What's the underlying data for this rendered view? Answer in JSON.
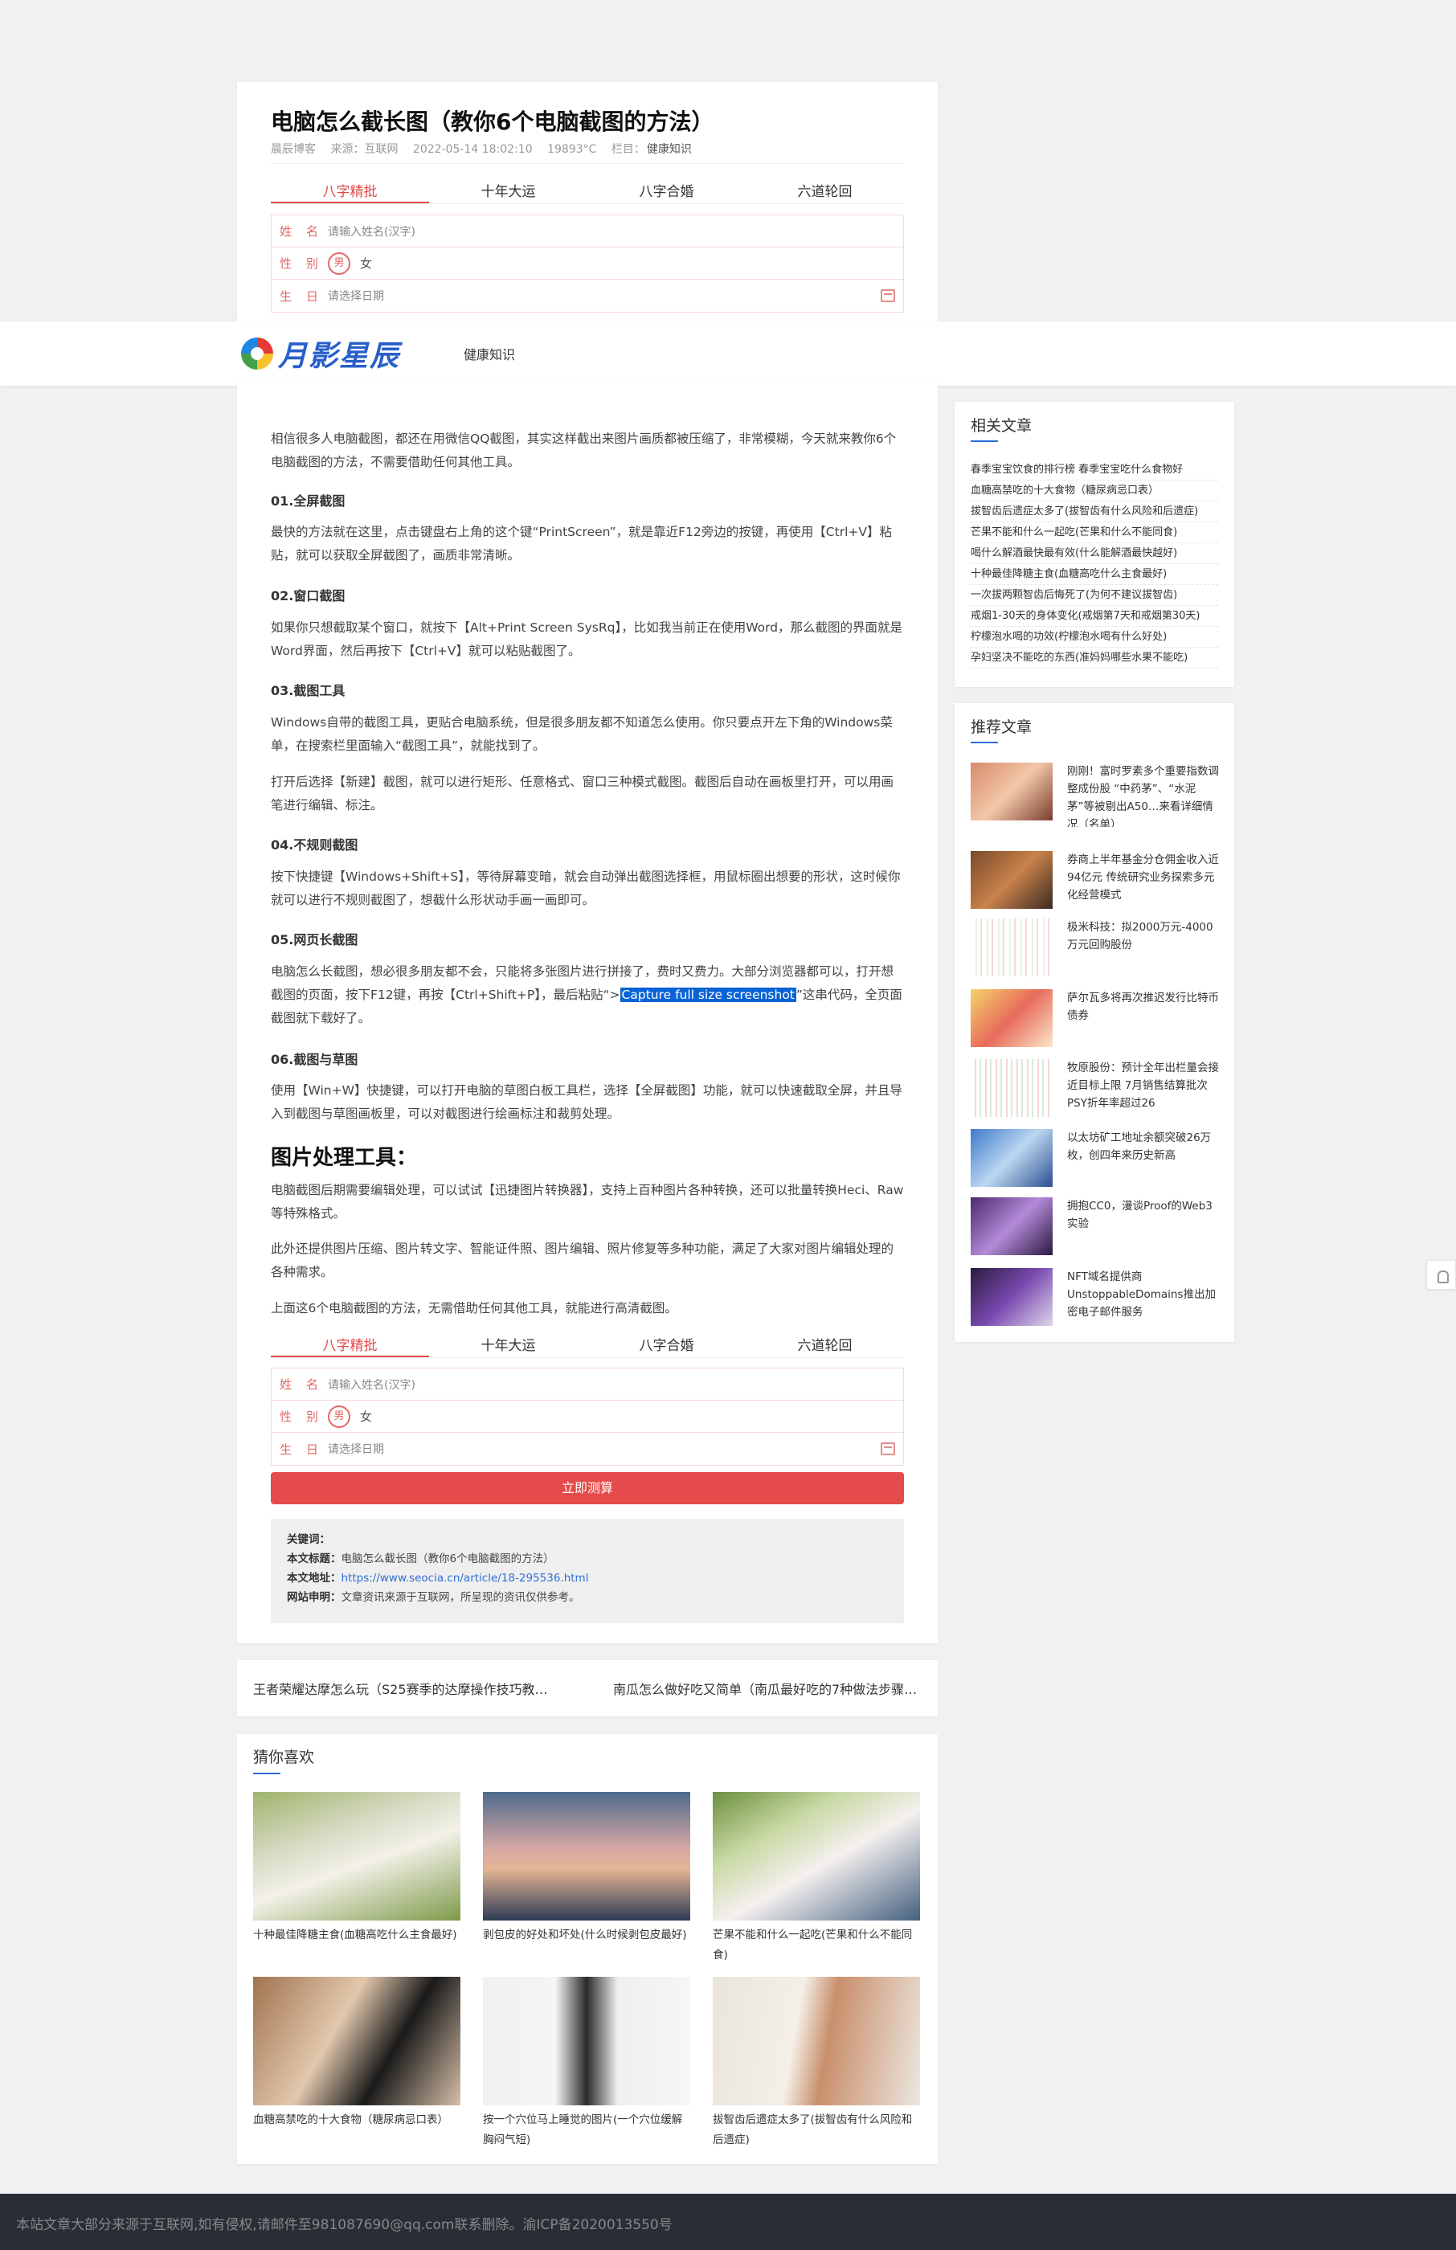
{
  "article": {
    "title": "电脑怎么截长图（教你6个电脑截图的方法）",
    "meta": {
      "author": "晨辰博客",
      "source": "来源：互联网",
      "date": "2022-05-14 18:02:10",
      "views": "19893°C",
      "category_label": "栏目：",
      "category": "健康知识"
    }
  },
  "fortune": {
    "tabs": [
      "八字精批",
      "十年大运",
      "八字合婚",
      "六道轮回"
    ],
    "name_label": "姓名",
    "name_placeholder": "请输入姓名(汉字)",
    "gender_label": "性别",
    "male": "男",
    "female": "女",
    "birth_label": "生日",
    "birth_placeholder": "请选择日期",
    "submit": "立即测算"
  },
  "header": {
    "logo_text": "月影星辰",
    "nav": [
      "健康知识"
    ]
  },
  "content": {
    "intro": "相信很多人电脑截图，都还在用微信QQ截图，其实这样截出来图片画质都被压缩了，非常模糊，今天就来教你6个电脑截图的方法，不需要借助任何其他工具。",
    "h1": "01.全屏截图",
    "p1": "最快的方法就在这里，点击键盘右上角的这个键“PrintScreen”，就是靠近F12旁边的按键，再使用【Ctrl+V】粘贴，就可以获取全屏截图了，画质非常清晰。",
    "h2": "02.窗口截图",
    "p2": "如果你只想截取某个窗口，就按下【Alt+Print Screen SysRq】，比如我当前正在使用Word，那么截图的界面就是Word界面，然后再按下【Ctrl+V】就可以粘贴截图了。",
    "h3": "03.截图工具",
    "p3a": "Windows自带的截图工具，更贴合电脑系统，但是很多朋友都不知道怎么使用。你只要点开左下角的Windows菜单，在搜索栏里面输入“截图工具”，就能找到了。",
    "p3b": "打开后选择【新建】截图，就可以进行矩形、任意格式、窗口三种模式截图。截图后自动在画板里打开，可以用画笔进行编辑、标注。",
    "h4": "04.不规则截图",
    "p4": "按下快捷键【Windows+Shift+S】，等待屏幕变暗，就会自动弹出截图选择框，用鼠标圈出想要的形状，这时候你就可以进行不规则截图了，想截什么形状动手画一画即可。",
    "h5": "05.网页长截图",
    "p5_before": "电脑怎么长截图，想必很多朋友都不会，只能将多张图片进行拼接了，费时又费力。大部分浏览器都可以，打开想截图的页面，按下F12键，再按【Ctrl+Shift+P】，最后粘贴“>",
    "p5_highlight": "Capture full size screenshot",
    "p5_after": "”这串代码，全页面截图就下载好了。",
    "h6": "06.截图与草图",
    "p6": "使用【Win+W】快捷键，可以打开电脑的草图白板工具栏，选择【全屏截图】功能，就可以快速截取全屏，并且导入到截图与草图画板里，可以对截图进行绘画标注和裁剪处理。",
    "h_tools": "图片处理工具：",
    "p7": "电脑截图后期需要编辑处理，可以试试【迅捷图片转换器】，支持上百种图片各种转换，还可以批量转换Heci、Raw等特殊格式。",
    "p8": "此外还提供图片压缩、图片转文字、智能证件照、图片编辑、照片修复等多种功能，满足了大家对图片编辑处理的各种需求。",
    "p9": "上面这6个电脑截图的方法，无需借助任何其他工具，就能进行高清截图。"
  },
  "keywords_box": {
    "kw_label": "关键词：",
    "title_label": "本文标题：",
    "title_value": "电脑怎么截长图（教你6个电脑截图的方法）",
    "url_label": "本文地址：",
    "url_value": "https://www.seocia.cn/article/18-295536.html",
    "notice_label": "网站申明：",
    "notice_value": "文章资讯来源于互联网，所呈现的资讯仅供参考。"
  },
  "prev_next": {
    "prev": "王者荣耀达摩怎么玩（S25赛季的达摩操作技巧教学…",
    "next": "南瓜怎么做好吃又简单（南瓜最好吃的7种做法步骤…"
  },
  "guess": {
    "title": "猜你喜欢",
    "items": [
      "十种最佳降糖主食(血糖高吃什么主食最好)",
      "剥包皮的好处和坏处(什么时候剥包皮最好)",
      "芒果不能和什么一起吃(芒果和什么不能同食)",
      "血糖高禁吃的十大食物（糖尿病忌口表）",
      "按一个穴位马上睡觉的图片(一个穴位缓解胸闷气短)",
      "拔智齿后遗症太多了(拔智齿有什么风险和后遗症)"
    ]
  },
  "related": {
    "title": "相关文章",
    "items": [
      "春季宝宝饮食的排行榜 春季宝宝吃什么食物好",
      "血糖高禁吃的十大食物（糖尿病忌口表）",
      "拔智齿后遗症太多了(拔智齿有什么风险和后遗症)",
      "芒果不能和什么一起吃(芒果和什么不能同食)",
      "喝什么解酒最快最有效(什么能解酒最快越好)",
      "十种最佳降糖主食(血糖高吃什么主食最好)",
      "一次拔两颗智齿后悔死了(为何不建议拔智齿)",
      "戒烟1-30天的身体变化(戒烟第7天和戒烟第30天)",
      "柠檬泡水喝的功效(柠檬泡水喝有什么好处)",
      "孕妇坚决不能吃的东西(准妈妈哪些水果不能吃)"
    ]
  },
  "recommend": {
    "title": "推荐文章",
    "items": [
      "刚刚！富时罗素多个重要指数调整成份股 “中药茅”、“水泥茅”等被剔出A50…来看详细情况（名单）",
      "券商上半年基金分仓佣金收入近94亿元 传统研究业务探索多元化经营模式",
      "极米科技：拟2000万元-4000万元回购股份",
      "萨尔瓦多将再次推迟发行比特币债券",
      "牧原股份：预计全年出栏量会接近目标上限 7月销售结算批次PSY折年率超过26",
      "以太坊矿工地址余额突破26万枚，创四年来历史新高",
      "拥抱CC0，漫谈Proof的Web3实验",
      "NFT域名提供商UnstoppableDomains推出加密电子邮件服务"
    ]
  },
  "footer": {
    "text": "本站文章大部分来源于互联网,如有侵权,请邮件至981087690@qq.com联系删除。渝ICP备2020013550号"
  }
}
